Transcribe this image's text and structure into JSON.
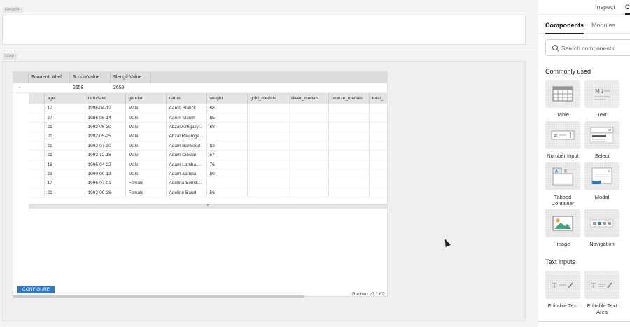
{
  "canvas": {
    "header_tag": "Header",
    "main_tag": "Main"
  },
  "widget": {
    "outer_headers": [
      "$currentLabel",
      "$countValue",
      "$lengthValue"
    ],
    "outer_row": [
      "-",
      "2658",
      "2659"
    ],
    "columns": [
      "age",
      "birthdate",
      "gender",
      "name",
      "weight",
      "gold_medals",
      "silver_medals",
      "bronze_medals",
      "total_"
    ],
    "rows": [
      [
        "17",
        "1996-04-12",
        "Male",
        "Aaron Blunck",
        "68",
        "",
        "",
        "",
        ""
      ],
      [
        "27",
        "1986-05-14",
        "Male",
        "Aaron March",
        "85",
        "",
        "",
        "",
        ""
      ],
      [
        "21",
        "1992-06-30",
        "Male",
        "Abzal Azhgaliy...",
        "68",
        "",
        "",
        "",
        ""
      ],
      [
        "21",
        "1992-05-25",
        "Male",
        "Abzal Rakimga...",
        "",
        "",
        "",
        "",
        ""
      ],
      [
        "21",
        "1992-07-30",
        "Male",
        "Adam Barwood",
        "82",
        "",
        "",
        "",
        ""
      ],
      [
        "21",
        "1992-12-18",
        "Male",
        "Adam Cieslar",
        "57",
        "",
        "",
        "",
        ""
      ],
      [
        "18",
        "1995-04-22",
        "Male",
        "Adam Lamha...",
        "76",
        "",
        "",
        "",
        ""
      ],
      [
        "23",
        "1990-09-13",
        "Male",
        "Adam Zampa",
        "80",
        "",
        "",
        "",
        ""
      ],
      [
        "17",
        "1996-07-01",
        "Female",
        "Adelina Sotnik...",
        "",
        "",
        "",
        "",
        ""
      ],
      [
        "21",
        "1992-09-28",
        "Female",
        "Adeline Baud",
        "56",
        "",
        "",
        "",
        ""
      ]
    ],
    "expand_marker": "+",
    "configure_label": "CONFIGURE",
    "brand": "Rechart v0.1.62"
  },
  "panel": {
    "top_tabs": [
      "Inspect",
      "C"
    ],
    "sub_tabs": [
      "Components",
      "Modules"
    ],
    "search_placeholder": "Search components",
    "groups": [
      {
        "title": "Commonly used",
        "items": [
          {
            "label": "Table",
            "icon": "table-icon"
          },
          {
            "label": "Text",
            "icon": "markdown-text-icon"
          },
          {
            "label": "Number Input",
            "icon": "number-input-icon"
          },
          {
            "label": "Select",
            "icon": "select-icon"
          },
          {
            "label": "Tabbed Container",
            "icon": "tabbed-container-icon"
          },
          {
            "label": "Modal",
            "icon": "modal-icon"
          },
          {
            "label": "Image",
            "icon": "image-icon"
          },
          {
            "label": "Navigation",
            "icon": "navigation-icon"
          }
        ]
      },
      {
        "title": "Text inputs",
        "items": [
          {
            "label": "Editable Text",
            "icon": "editable-text-icon"
          },
          {
            "label": "Editable Text Area",
            "icon": "editable-text-area-icon"
          }
        ]
      }
    ]
  },
  "colors": {
    "accent": "#2e77c4",
    "canvas_bg": "#f3f3f3",
    "table_header_bg": "#dcdcdc"
  }
}
